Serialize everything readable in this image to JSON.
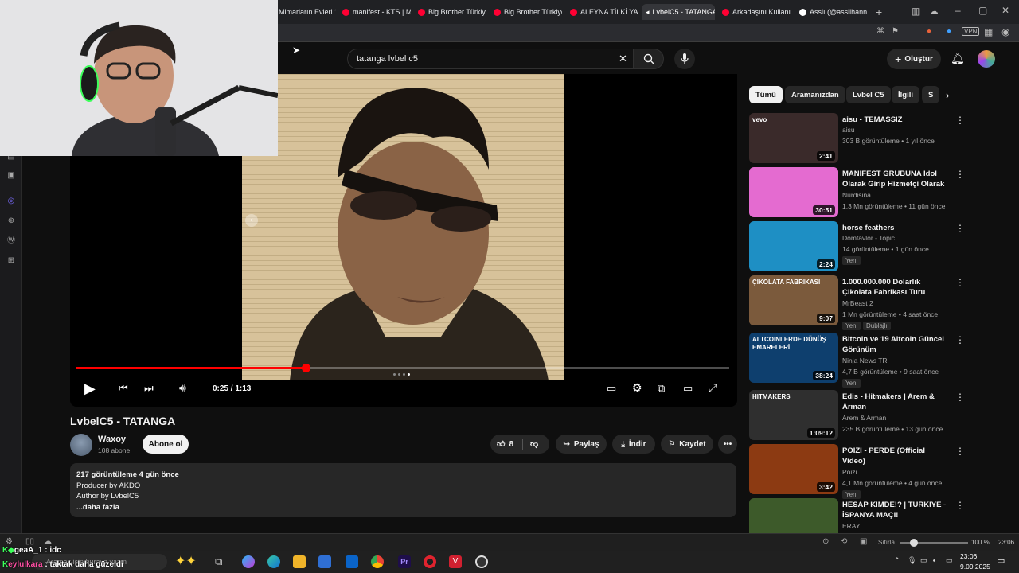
{
  "browser": {
    "tabs": [
      {
        "label": "Mimarların Evleri 1. ",
        "active": false
      },
      {
        "label": "manifest - KTS | Mu",
        "active": false
      },
      {
        "label": "Big Brother Türkiye",
        "active": false
      },
      {
        "label": "Big Brother Türkiye",
        "active": false
      },
      {
        "label": "ALEYNA TİLKİ YALAN",
        "active": false
      },
      {
        "label": "LvbelC5 - TATANGA",
        "active": true
      },
      {
        "label": "Arkadaşını Kullanıp",
        "active": false
      },
      {
        "label": "Asslı (@asslihann1)",
        "active": false
      }
    ],
    "vpn_label": "VPN"
  },
  "header": {
    "search_value": "tatanga lvbel c5",
    "create_label": "Oluştur"
  },
  "player": {
    "time": "0:25 / 1:13",
    "progress_fraction": 0.351
  },
  "video": {
    "title": "LvbelC5 - TATANGA",
    "channel": "Waxoy",
    "subs": "108 abone",
    "subscribe_label": "Abone ol",
    "likes": "8",
    "share_label": "Paylaş",
    "download_label": "İndir",
    "save_label": "Kaydet",
    "desc_stats": "217 görüntüleme  4 gün önce",
    "desc_lines": [
      "Producer by AKDO",
      "Author by LvbelC5"
    ],
    "more_label": "...daha fazla"
  },
  "chips": [
    "Tümü",
    "Aramanızdan",
    "Lvbel C5",
    "İlgili",
    "S"
  ],
  "recommendations": [
    {
      "title": "aisu - TEMASSIZ",
      "channel": "aisu",
      "meta": "303 B görüntüleme • 1 yıl önce",
      "duration": "2:41",
      "badge": "",
      "thumb_color": "#3a2a2a",
      "thumb_label": "vevo"
    },
    {
      "title": "MANİFEST GRUBUNA İdol Olarak Girip Hizmetçi Olarak ...",
      "channel": "Nurdisina",
      "meta": "1,3 Mn görüntüleme • 11 gün önce",
      "duration": "30:51",
      "badge": "",
      "thumb_color": "#e46bd0",
      "thumb_label": ""
    },
    {
      "title": "horse feathers",
      "channel": "Domtavlor - Topic",
      "meta": "14 görüntüleme • 1 gün önce",
      "duration": "2:24",
      "badge": "Yeni",
      "thumb_color": "#1e8fc4",
      "thumb_label": ""
    },
    {
      "title": "1.000.000.000 Dolarlık Çikolata Fabrikası Turu",
      "channel": "MrBeast 2",
      "meta": "1 Mn görüntüleme • 4 saat önce",
      "duration": "9:07",
      "badge": "Yeni",
      "badge2": "Dublajlı",
      "thumb_color": "#7b5a3c",
      "thumb_label": "ÇİKOLATA FABRİKASI"
    },
    {
      "title": "Bitcoin ve 19 Altcoin Güncel Görünüm",
      "channel": "Ninja News TR",
      "meta": "4,7 B görüntüleme • 9 saat önce",
      "duration": "38:24",
      "badge": "Yeni",
      "thumb_color": "#0e3f6e",
      "thumb_label": "ALTCOINLERDE DÜNÜŞ EMARELERİ"
    },
    {
      "title": "Edis - Hitmakers | Arem & Arman",
      "channel": "Arem & Arman",
      "meta": "235 B görüntüleme • 13 gün önce",
      "duration": "1:09:12",
      "badge": "",
      "thumb_color": "#2f2f2f",
      "thumb_label": "HITMAKERS"
    },
    {
      "title": "POIZI - PERDE (Official Video)",
      "channel": "Poizi",
      "meta": "4,1 Mn görüntüleme • 4 gün önce",
      "duration": "3:42",
      "badge": "Yeni",
      "thumb_color": "#8c3a12",
      "thumb_label": ""
    },
    {
      "title": "HESAP KİMDE!? | TÜRKİYE - İSPANYA MAÇI!",
      "channel": "ERAY",
      "meta": "",
      "duration": "",
      "badge": "",
      "thumb_color": "#3d5a2a",
      "thumb_label": ""
    }
  ],
  "statusbar": {
    "zoom": "100 %",
    "time": "23:06",
    "page_label": "Sıfırla"
  },
  "taskbar": {
    "time": "23:06",
    "date": "9.09.2025",
    "search_placeholder": "Aramak için buraya yazın"
  },
  "chat": {
    "line1_user": "geaA_1",
    "line1_msg": " : idc",
    "line2_user": "eylulkara",
    "line2_msg": " : taktak daha güzeldi"
  }
}
